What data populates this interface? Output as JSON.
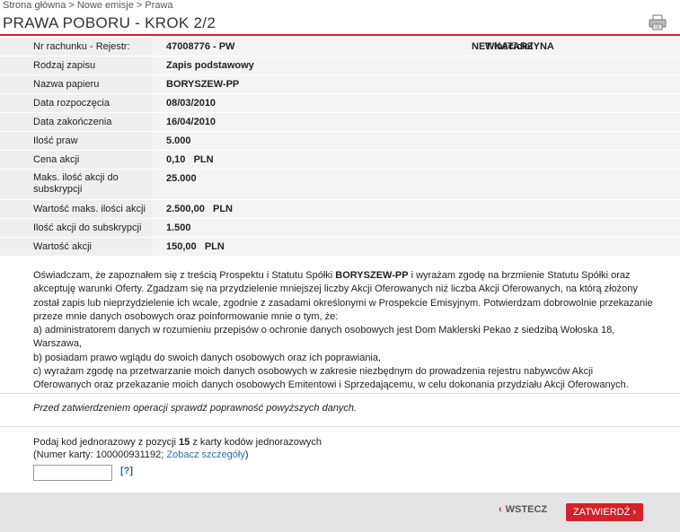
{
  "breadcrumb": "Strona główna > Nowe emisje > Prawa",
  "page_title": "PRAWA POBORU - KROK 2/2",
  "account": {
    "label": "Nr rachunku - Rejestr:",
    "value": "47008776 - PW",
    "owner_label": "Właściciel rachunku:",
    "owner_value": "NET KATARZYNA"
  },
  "rows": [
    {
      "label": "Rodzaj zapisu",
      "value": "Zapis podstawowy"
    },
    {
      "label": "Nazwa papieru",
      "value": "BORYSZEW-PP"
    },
    {
      "label": "Data rozpoczęcia",
      "value": "08/03/2010"
    },
    {
      "label": "Data zakończenia",
      "value": "16/04/2010"
    },
    {
      "label": "Ilość praw",
      "value": "5.000"
    },
    {
      "label": "Cena akcji",
      "value": "0,10   PLN"
    },
    {
      "label": "Maks. ilość akcji do subskrypcji",
      "value": "25.000"
    },
    {
      "label": "Wartość maks. ilości akcji",
      "value": "2.500,00   PLN"
    },
    {
      "label": "Ilość akcji do subskrypcji",
      "value": "1.500"
    },
    {
      "label": "Wartość akcji",
      "value": "150,00   PLN"
    }
  ],
  "declaration": {
    "part1": "Oświadczam, że zapoznałem się z treścią Prospektu i Statutu Spółki ",
    "company": "BORYSZEW-PP",
    "part2": " i wyrażam zgodę na brzmienie Statutu Spółki oraz akceptuję warunki Oferty. Zgadzam się na przydzielenie mniejszej liczby Akcji Oferowanych niż liczba Akcji Oferowanych, na którą złożony został zapis lub nieprzydzielenie ich wcale, zgodnie z zasadami określonymi w Prospekcie Emisyjnym. Potwierdzam dobrowolnie przekazanie przeze mnie danych osobowych oraz poinformowanie mnie o tym, że:",
    "point_a": "a) administratorem danych w rozumieniu przepisów o ochronie danych osobowych jest Dom Maklerski Pekao z siedzibą Wołoska 18, Warszawa,",
    "point_b": "b) posiadam prawo wglądu do swoich danych osobowych oraz ich poprawiania,",
    "point_c": "c) wyrażam zgodę na przetwarzanie moich danych osobowych w zakresie niezbędnym do prowadzenia rejestru nabywców Akcji Oferowanych oraz przekazanie moich danych osobowych Emitentowi i Sprzedającemu, w celu dokonania przydziału Akcji Oferowanych."
  },
  "warning": "Przed zatwierdzeniem operacji sprawdź poprawność powyższych danych.",
  "code": {
    "prompt_pre": "Podaj kod jednorazowy z pozycji ",
    "position": "15",
    "prompt_post": " z karty kodów jednorazowych",
    "card_pre": "(Numer karty: 100000931192;  ",
    "details_link": "Zobacz szczegóły",
    "card_post": ")",
    "help": "[?]",
    "input_value": ""
  },
  "buttons": {
    "back": "WSTECZ",
    "confirm": "ZATWIERDŹ"
  },
  "colors": {
    "accent": "#d2232a",
    "link": "#2c6da4"
  }
}
